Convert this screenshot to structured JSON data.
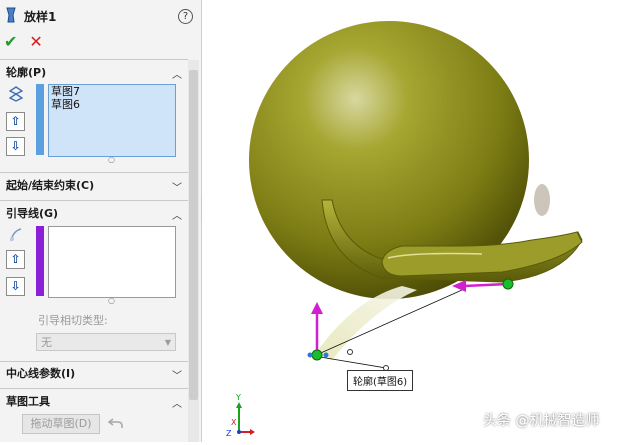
{
  "feature": {
    "title": "放样1",
    "help": "?"
  },
  "actions": {
    "ok": "✔",
    "cancel": "✕"
  },
  "profiles": {
    "header": "轮廓(P)",
    "items": [
      "草图7",
      "草图6"
    ],
    "color": "#5aa0e0"
  },
  "start_end": {
    "header": "起始/结束约束(C)"
  },
  "guides": {
    "header": "引导线(G)",
    "tangency_label": "引导相切类型:",
    "tangency_value": "无",
    "color": "#8a1fd6"
  },
  "centerline": {
    "header": "中心线参数(I)"
  },
  "sketch_tools": {
    "header": "草图工具",
    "drag_button": "拖动草图(D)"
  },
  "viewport": {
    "callout": "轮廓(草图6)",
    "part_color": "#8a8a1a"
  },
  "watermark": "头条 @机械智造师",
  "axis": {
    "x": "X",
    "y": "Y",
    "z": "Z"
  }
}
